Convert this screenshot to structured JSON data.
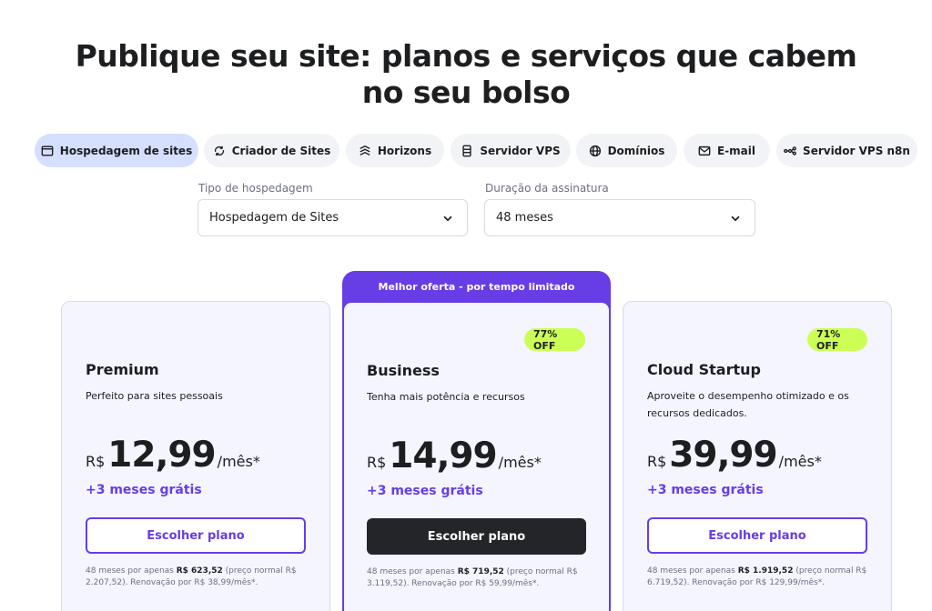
{
  "header": {
    "title_line1": "Publique seu site: planos e serviços que cabem",
    "title_line2": "no seu bolso"
  },
  "tabs": [
    {
      "label": "Hospedagem de sites",
      "icon": "browser-window-icon",
      "active": true
    },
    {
      "label": "Criador de Sites",
      "icon": "builder-refresh-icon",
      "active": false
    },
    {
      "label": "Horizons",
      "icon": "horizons-icon",
      "active": false
    },
    {
      "label": "Servidor VPS",
      "icon": "server-icon",
      "active": false
    },
    {
      "label": "Domínios",
      "icon": "globe-icon",
      "active": false
    },
    {
      "label": "E-mail",
      "icon": "mail-icon",
      "active": false
    },
    {
      "label": "Servidor VPS n8n",
      "icon": "n8n-icon",
      "active": false
    }
  ],
  "filters": {
    "hosting_type": {
      "label": "Tipo de hospedagem",
      "value": "Hospedagem de Sites"
    },
    "duration": {
      "label": "Duração da assinatura",
      "value": "48 meses"
    }
  },
  "best_offer_banner": "Melhor oferta - por tempo limitado",
  "plans": [
    {
      "name": "Premium",
      "description": "Perfeito para sites pessoais",
      "currency": "R$",
      "price": "12,99",
      "suffix": "/mês*",
      "bonus": "+3 meses grátis",
      "cta": "Escolher plano",
      "fine_prefix": "48 meses por apenas ",
      "fine_total": "R$ 623,52",
      "fine_suffix": " (preço normal R$ 2.207,52). Renovação por R$ 38,99/mês*."
    },
    {
      "name": "Business",
      "badge": "77% OFF",
      "description": "Tenha mais potência e recursos",
      "currency": "R$",
      "price": "14,99",
      "suffix": "/mês*",
      "bonus": "+3 meses grátis",
      "cta": "Escolher plano",
      "fine_prefix": "48 meses por apenas ",
      "fine_total": "R$ 719,52",
      "fine_suffix": " (preço normal R$ 3.119,52). Renovação por R$ 59,99/mês*."
    },
    {
      "name": "Cloud Startup",
      "badge": "71% OFF",
      "description": "Aproveite o desempenho otimizado e os recursos dedicados.",
      "currency": "R$",
      "price": "39,99",
      "suffix": "/mês*",
      "bonus": "+3 meses grátis",
      "cta": "Escolher plano",
      "fine_prefix": "48 meses por apenas ",
      "fine_total": "R$ 1.919,52",
      "fine_suffix": " (preço normal R$ 6.719,52). Renovação por R$ 129,99/mês*."
    }
  ],
  "colors": {
    "accent": "#673de6",
    "active_tab": "#d5dfff",
    "badge": "#ccff55",
    "card_bg": "#f4f5ff",
    "dark_button": "#242529"
  }
}
